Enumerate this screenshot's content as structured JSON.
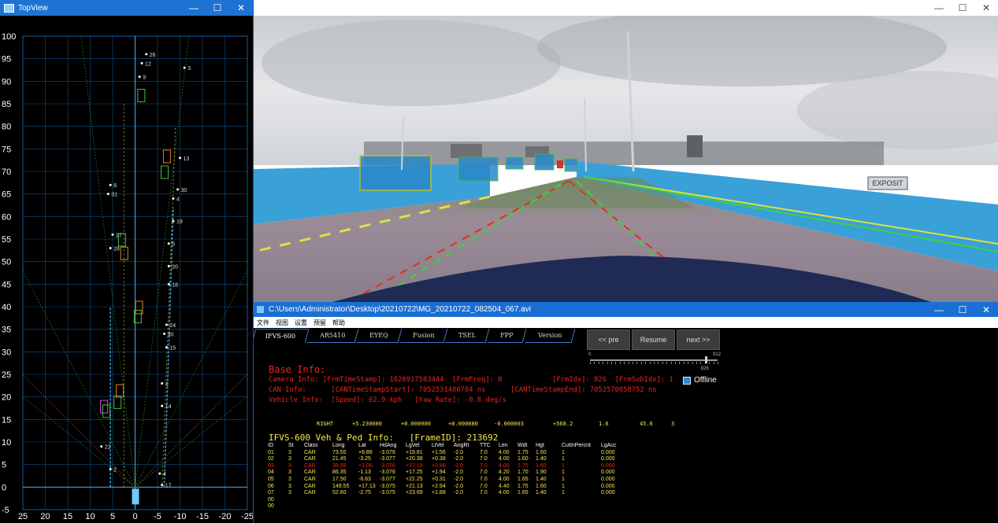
{
  "topview": {
    "title": "TopView",
    "y_ticks": [
      "100",
      "95",
      "90",
      "85",
      "80",
      "75",
      "70",
      "65",
      "60",
      "55",
      "50",
      "45",
      "40",
      "35",
      "30",
      "25",
      "20",
      "15",
      "10",
      "5",
      "0",
      "-5"
    ],
    "x_ticks": [
      "25",
      "20",
      "15",
      "10",
      "5",
      "0",
      "-5",
      "-10",
      "-15",
      "-20",
      "-25"
    ],
    "point_labels": [
      "26",
      "12",
      "3",
      "9",
      "13",
      "8",
      "30",
      "31",
      "4",
      "19",
      "27",
      "5",
      "28",
      "20",
      "18",
      "24",
      "30",
      "15",
      "1",
      "14",
      "22",
      "2",
      "4",
      "17"
    ]
  },
  "camera": {
    "sign_text": "EXPOSIT"
  },
  "main": {
    "title": "C:\\Users\\Administrator\\Desktop\\20210722\\MG_20210722_082504_067.avi",
    "menu": [
      "文件",
      "视图",
      "设置",
      "预留",
      "帮助"
    ],
    "tabs": [
      "IFVS-600",
      "AR5410",
      "EYEQ",
      "Fusion",
      "TSEL",
      "FPP",
      "Version"
    ],
    "buttons": {
      "pre": "<< pre",
      "resume": "Resume",
      "next": "next >>"
    },
    "slider": {
      "min": "0",
      "max": "912",
      "current": "826",
      "value_fraction": 0.906
    },
    "offline_label": "Offline",
    "base_info_title": "Base Info:",
    "camera_info": "Camera Info: [FrmTimeStamp]: 1626917583444  [FrmFreq]: 0            [FrmIdx]: 826  [FrmSubIdx]: 1",
    "can_info": "CAN Info:      [CANTimeStampStart]: 7052531480704 ns      [CANTimeStampEnd]: 7052570058752 ns",
    "vehicle_info": "Vehicle Info:  [Speed]: 62.9 kph   [Yaw Rate]: -0.8 deg/s",
    "right_line": [
      "RIGHT",
      "+5.230000",
      "+0.000900",
      "+0.000880",
      "-0.000003",
      "+568.2",
      "1.6",
      "45.6",
      "3"
    ],
    "veh_title": "IFVS-600 Veh & Ped Info:   [FrameID]: 213692",
    "columns": [
      "ID",
      "St",
      "Class",
      "Long",
      "Lat",
      "HdAng",
      "LgVel",
      "LtVel",
      "AngRt",
      "TTC",
      "Len",
      "Wdt",
      "Hgt",
      "CutInPercnt",
      "LgAcc"
    ],
    "rows": [
      [
        "01",
        "3",
        "CAR",
        "73.55",
        "+6.88",
        "-3.076",
        "+19.81",
        "+1.56",
        "-2.0",
        "7.0",
        "4.00",
        "1.75",
        "1.60",
        "1",
        "0.000"
      ],
      [
        "02",
        "3",
        "CAR",
        "21.45",
        "-3.25",
        "-3.077",
        "+20.38",
        "+0.38",
        "-2.0",
        "7.0",
        "4.00",
        "1.60",
        "1.40",
        "1",
        "0.000"
      ],
      [
        "03",
        "3",
        "CAR",
        "39.55",
        "+1.06",
        "-3.076",
        "+17.19",
        "+0.88",
        "-2.0",
        "7.0",
        "4.00",
        "1.75",
        "1.60",
        "1",
        "0.000"
      ],
      [
        "04",
        "3",
        "CAR",
        "86.35",
        "-1.13",
        "-3.076",
        "+17.25",
        "+1.94",
        "-2.0",
        "7.0",
        "4.20",
        "1.70",
        "1.90",
        "1",
        "0.000"
      ],
      [
        "05",
        "3",
        "CAR",
        "17.50",
        "-6.63",
        "-3.077",
        "+22.25",
        "+0.31",
        "-2.0",
        "7.0",
        "4.00",
        "1.65",
        "1.40",
        "1",
        "0.000"
      ],
      [
        "06",
        "3",
        "CAR",
        "149.55",
        "+17.13",
        "-3.075",
        "+21.13",
        "+2.94",
        "-2.0",
        "7.0",
        "4.40",
        "1.75",
        "1.60",
        "1",
        "0.000"
      ],
      [
        "07",
        "3",
        "CAR",
        "52.60",
        "-2.75",
        "-3.075",
        "+23.69",
        "+1.88",
        "-2.0",
        "7.0",
        "4.00",
        "1.65",
        "1.40",
        "1",
        "0.000"
      ],
      [
        "00",
        "",
        "",
        "",
        "",
        "",
        "",
        "",
        "",
        "",
        "",
        "",
        "",
        "",
        ""
      ],
      [
        "00",
        "",
        "",
        "",
        "",
        "",
        "",
        "",
        "",
        "",
        "",
        "",
        "",
        "",
        ""
      ]
    ],
    "highlight_row": 2,
    "colors": {
      "title_blue": "#1a6fd4",
      "accent_red": "#e8261f",
      "accent_yellow": "#f5e84a"
    }
  }
}
